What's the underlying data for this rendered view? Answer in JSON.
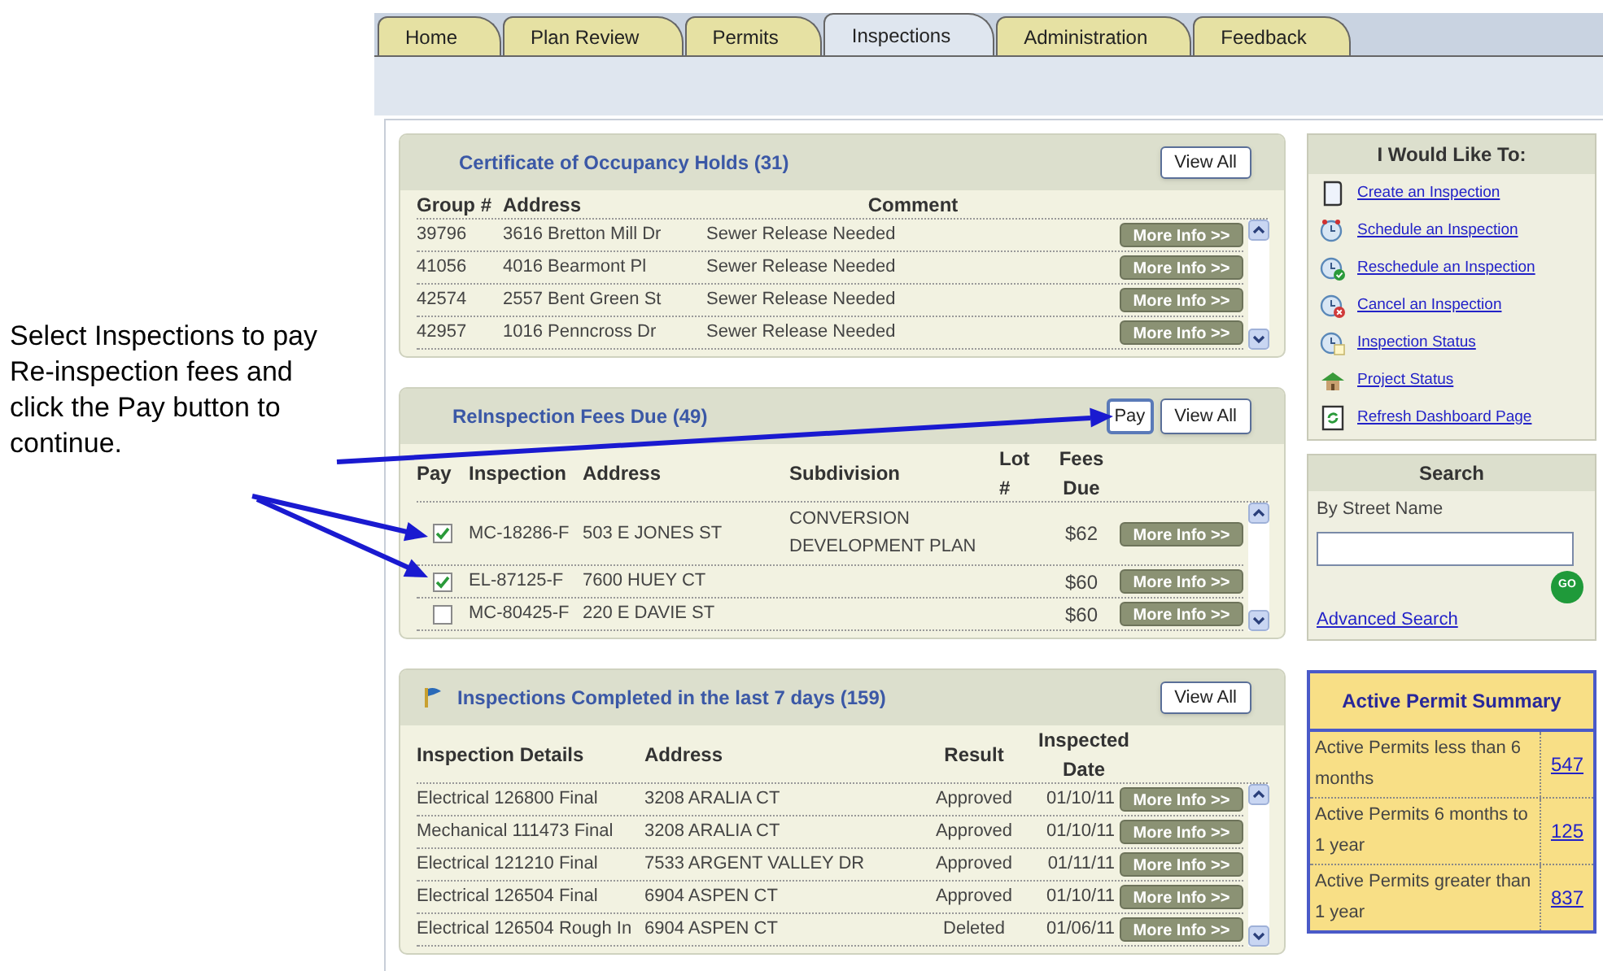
{
  "callout": {
    "text": "Select Inspections to pay Re-inspection fees and click the Pay button to continue."
  },
  "tabs": [
    {
      "label": "Home",
      "selected": false
    },
    {
      "label": "Plan Review",
      "selected": false
    },
    {
      "label": "Permits",
      "selected": false
    },
    {
      "label": "Inspections",
      "selected": true
    },
    {
      "label": "Administration",
      "selected": false
    },
    {
      "label": "Feedback",
      "selected": false
    }
  ],
  "co_holds": {
    "title": "Certificate of Occupancy Holds (31)",
    "view_all": "View All",
    "columns": [
      "Group #",
      "Address",
      "Comment"
    ],
    "rows": [
      {
        "group": "39796",
        "address": "3616 Bretton Mill Dr",
        "comment": "Sewer Release Needed",
        "button": "More Info >>"
      },
      {
        "group": "41056",
        "address": "4016 Bearmont Pl",
        "comment": "Sewer Release Needed",
        "button": "More Info >>"
      },
      {
        "group": "42574",
        "address": "2557 Bent Green St",
        "comment": "Sewer Release Needed",
        "button": "More Info >>"
      },
      {
        "group": "42957",
        "address": "1016 Penncross Dr",
        "comment": "Sewer Release Needed",
        "button": "More Info >>"
      }
    ]
  },
  "reinspection_fees": {
    "title": "ReInspection Fees Due (49)",
    "pay_button": "Pay",
    "view_all": "View All",
    "columns": [
      "Pay",
      "Inspection",
      "Address",
      "Subdivision",
      "Lot #",
      "Fees Due"
    ],
    "rows": [
      {
        "checked": true,
        "inspection": "MC-18286-F",
        "address": "503 E JONES ST",
        "subdivision": "CONVERSION DEVELOPMENT PLAN",
        "fees": "$62",
        "button": "More Info >>"
      },
      {
        "checked": true,
        "inspection": "EL-87125-F",
        "address": "7600 HUEY CT",
        "fees": "$60",
        "button": "More Info >>"
      },
      {
        "checked": false,
        "inspection": "MC-80425-F",
        "address": "220 E DAVIE ST",
        "fees": "$60",
        "button": "More Info >>"
      }
    ]
  },
  "completed": {
    "title": "Inspections Completed in the last 7 days (159)",
    "view_all": "View All",
    "columns": [
      "Inspection Details",
      "Address",
      "Result",
      "Inspected Date"
    ],
    "rows": [
      {
        "details": "Electrical 126800 Final",
        "address": "3208 ARALIA CT",
        "result": "Approved",
        "date": "01/10/11",
        "button": "More Info >>"
      },
      {
        "details": "Mechanical 111473 Final",
        "address": "3208 ARALIA CT",
        "result": "Approved",
        "date": "01/10/11",
        "button": "More Info >>"
      },
      {
        "details": "Electrical 121210 Final",
        "address": "7533 ARGENT VALLEY DR",
        "result": "Approved",
        "date": "01/11/11",
        "button": "More Info >>"
      },
      {
        "details": "Electrical 126504 Final",
        "address": "6904 ASPEN CT",
        "result": "Approved",
        "date": "01/10/11",
        "button": "More Info >>"
      },
      {
        "details": "Electrical 126504 Rough In",
        "address": "6904 ASPEN CT",
        "result": "Deleted",
        "date": "01/06/11",
        "button": "More Info >>"
      }
    ]
  },
  "actions": {
    "title": "I Would Like To:",
    "items": [
      {
        "label": "Create an Inspection",
        "kind": "document"
      },
      {
        "label": "Schedule an Inspection",
        "kind": "alarm"
      },
      {
        "label": "Reschedule an Inspection",
        "kind": "check"
      },
      {
        "label": "Cancel an Inspection",
        "kind": "cancel"
      },
      {
        "label": "Inspection Status",
        "kind": "status"
      },
      {
        "label": "Project Status",
        "kind": "house"
      },
      {
        "label": "Refresh Dashboard Page",
        "kind": "refresh"
      }
    ]
  },
  "search": {
    "title": "Search",
    "label": "By Street Name",
    "go_button": "GO",
    "advanced_link": "Advanced Search"
  },
  "permit_summary": {
    "title": "Active Permit Summary",
    "rows": [
      {
        "label": "Active Permits less than 6 months",
        "value": "547"
      },
      {
        "label": "Active Permits 6 months to 1 year",
        "value": "125"
      },
      {
        "label": "Active Permits greater than 1 year",
        "value": "837"
      }
    ]
  }
}
